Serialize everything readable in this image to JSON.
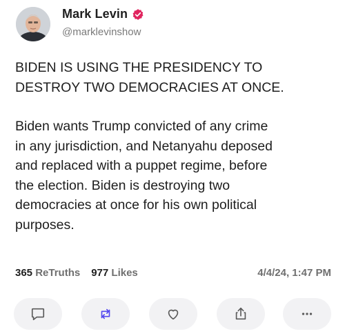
{
  "user": {
    "display_name": "Mark Levin",
    "handle": "@marklevinshow",
    "verified": true,
    "verified_color": "#e0245e"
  },
  "post": {
    "headline": "BIDEN IS USING THE PRESIDENCY TO\nDESTROY TWO DEMOCRACIES AT ONCE.",
    "body": "Biden wants Trump convicted of any crime\nin any jurisdiction, and Netanyahu deposed\nand replaced with a puppet regime, before\nthe election.  Biden is destroying two\ndemocracies at once for his own political\npurposes."
  },
  "stats": {
    "retruths_count": "365",
    "retruths_label": "ReTruths",
    "likes_count": "977",
    "likes_label": "Likes",
    "timestamp": "4/4/24, 1:47 PM"
  },
  "actions": [
    {
      "name": "reply",
      "icon": "speech-bubble-icon"
    },
    {
      "name": "retruth",
      "icon": "repost-arrows-icon",
      "color": "#5448ee"
    },
    {
      "name": "like",
      "icon": "heart-icon"
    },
    {
      "name": "share",
      "icon": "share-icon"
    },
    {
      "name": "more",
      "icon": "more-dots-icon"
    }
  ]
}
